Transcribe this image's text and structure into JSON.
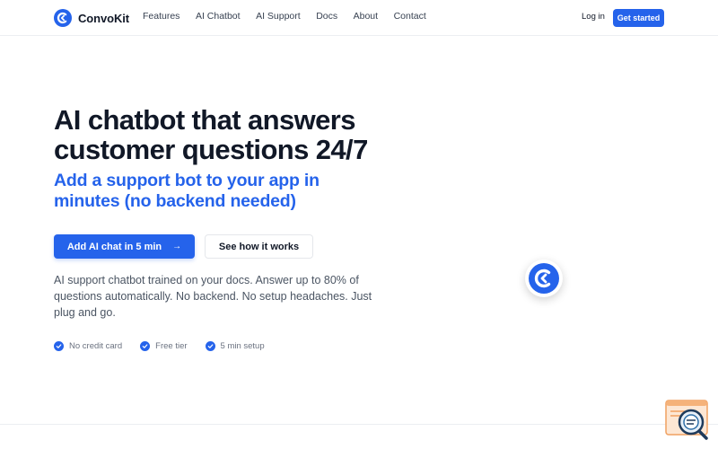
{
  "nav": {
    "brand": "ConvoKit",
    "links": [
      "Features",
      "AI Chatbot",
      "AI Support",
      "Docs",
      "About",
      "Contact"
    ],
    "login": "Log in",
    "cta": "Get started"
  },
  "hero": {
    "title_line1": "AI chatbot that answers",
    "title_line2": "customer questions 24/7",
    "subtitle_line1": "Add a support bot to your app in",
    "subtitle_line2": "minutes (no backend needed)",
    "primary_button": "Add AI chat in 5 min",
    "primary_arrow": "→",
    "secondary_button": "See how it works",
    "description": "AI support chatbot trained on your docs. Answer up to 80% of questions automatically. No backend. No setup headaches. Just plug and go.",
    "badges": [
      "No credit card",
      "Free tier",
      "5 min setup"
    ]
  },
  "icons": {
    "brand_logo": "convokit-logo-icon",
    "badge_check": "check-circle-icon",
    "floating": "convokit-floating-logo-icon",
    "widget": "chat-widget-search-icon"
  },
  "colors": {
    "primary": "#2563eb",
    "text": "#111827",
    "muted": "#4b5563"
  }
}
